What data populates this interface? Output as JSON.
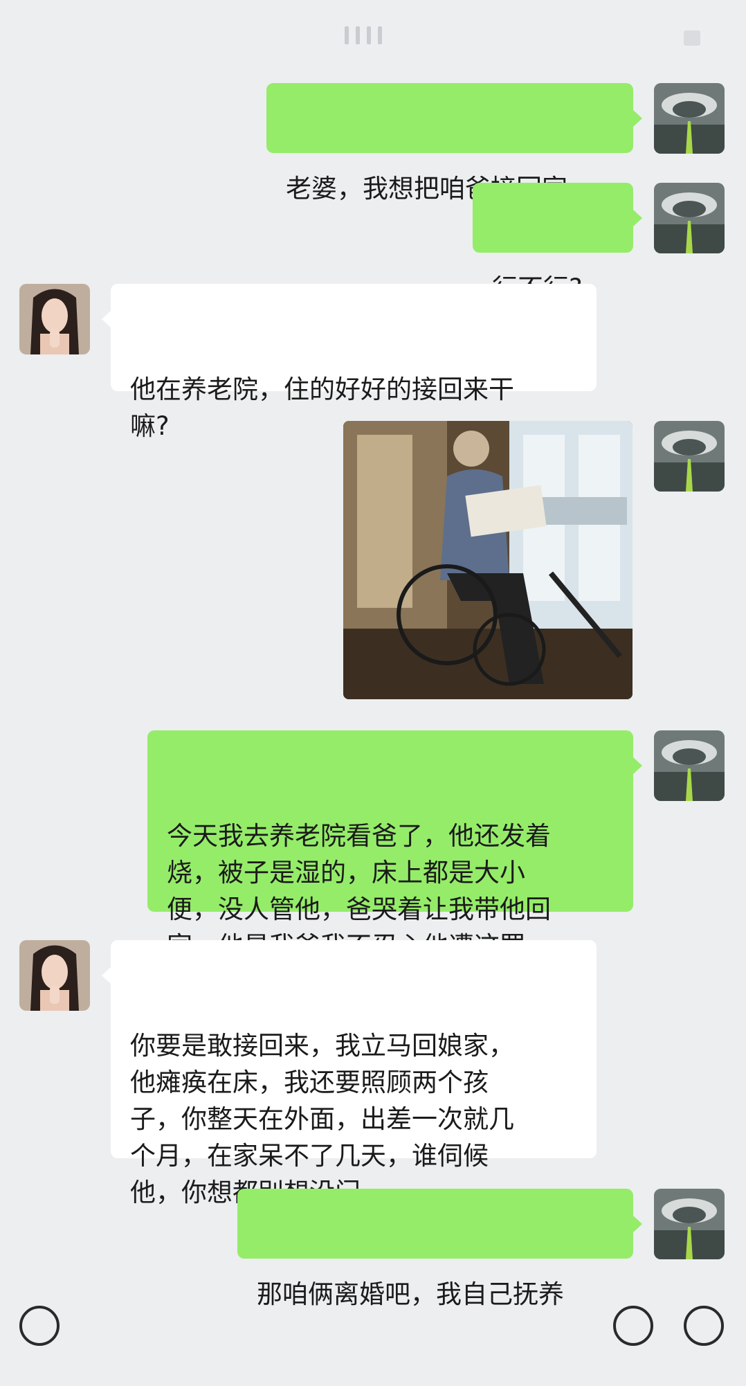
{
  "messages": [
    {
      "side": "me",
      "text": "老婆，我想把咱爸接回家"
    },
    {
      "side": "me",
      "text": "行不行?"
    },
    {
      "side": "wife",
      "text": "他在养老院，住的好好的接回来干\n嘛?"
    },
    {
      "side": "me",
      "type": "image"
    },
    {
      "side": "me",
      "text": "今天我去养老院看爸了，他还发着\n烧，被子是湿的，床上都是大小\n便，没人管他，爸哭着让我带他回\n家，他是我爸我不忍心他遭这罪"
    },
    {
      "side": "wife",
      "text": "你要是敢接回来，我立马回娘家，\n他瘫痪在床，我还要照顾两个孩\n子，你整天在外面，出差一次就几\n个月，在家呆不了几天，谁伺候\n他，你想都别想没门"
    },
    {
      "side": "me",
      "text": "那咱俩离婚吧，我自己抚养"
    }
  ],
  "colors": {
    "background": "#eceef0",
    "sent_bubble": "#95ec69",
    "received_bubble": "#ffffff"
  },
  "icons": {
    "bottom_left": "voice-icon",
    "bottom_right_1": "emoji-icon",
    "bottom_right_2": "plus-icon"
  }
}
